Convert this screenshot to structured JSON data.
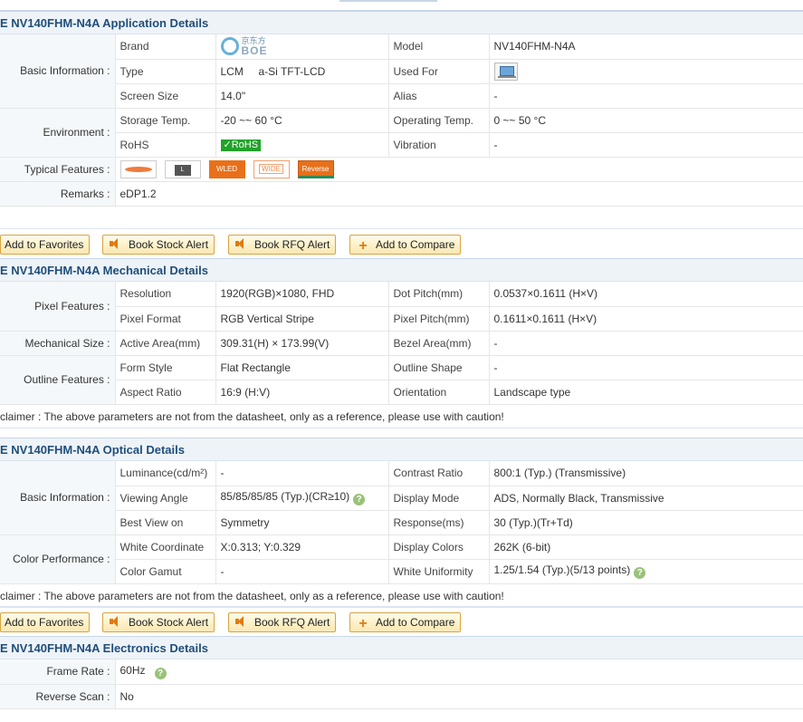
{
  "application": {
    "title": "E NV140FHM-N4A Application Details",
    "groups": {
      "basic": "Basic Information :",
      "environment": "Environment :",
      "features": "Typical Features :",
      "remarks": "Remarks :"
    },
    "rows": {
      "brand_label": "Brand",
      "brand_logo_cn": "京东方",
      "brand_logo_en": "BOE",
      "model_label": "Model",
      "model_value": "NV140FHM-N4A",
      "type_label": "Type",
      "type_value": "LCM     a-Si TFT-LCD",
      "usedfor_label": "Used For",
      "size_label": "Screen Size",
      "size_value": "14.0\"",
      "alias_label": "Alias",
      "alias_value": "-",
      "storage_label": "Storage Temp.",
      "storage_value": "-20 ~~ 60 °C",
      "operating_label": "Operating Temp.",
      "operating_value": "0 ~~ 50 °C",
      "rohs_label": "RoHS",
      "rohs_value": "✓RoHS",
      "vibration_label": "Vibration",
      "vibration_value": "-",
      "remarks_value": "eDP1.2"
    },
    "features": [
      "L",
      "WLED",
      "WIDE",
      "Reverse"
    ]
  },
  "actions": {
    "favorites": "Add to Favorites",
    "stock_alert": "Book Stock Alert",
    "rfq_alert": "Book RFQ Alert",
    "compare": "Add to Compare"
  },
  "mechanical": {
    "title": "E NV140FHM-N4A Mechanical Details",
    "groups": {
      "pixel": "Pixel Features :",
      "size": "Mechanical Size :",
      "outline": "Outline Features :"
    },
    "rows": {
      "resolution_label": "Resolution",
      "resolution_value": "1920(RGB)×1080, FHD",
      "dotpitch_label": "Dot Pitch(mm)",
      "dotpitch_value": "0.0537×0.1611 (H×V)",
      "pixelformat_label": "Pixel Format",
      "pixelformat_value": "RGB Vertical Stripe",
      "pixelpitch_label": "Pixel Pitch(mm)",
      "pixelpitch_value": "0.1611×0.1611 (H×V)",
      "activearea_label": "Active Area(mm)",
      "activearea_value": "309.31(H) × 173.99(V)",
      "bezel_label": "Bezel Area(mm)",
      "bezel_value": "-",
      "formstyle_label": "Form Style",
      "formstyle_value": "Flat Rectangle",
      "outlineshape_label": "Outline Shape",
      "outlineshape_value": "-",
      "aspect_label": "Aspect Ratio",
      "aspect_value": "16:9 (H:V)",
      "orientation_label": "Orientation",
      "orientation_value": "Landscape type"
    },
    "disclaimer": "claimer : The above parameters are not from the datasheet, only as a reference, please use with caution!"
  },
  "optical": {
    "title": "E NV140FHM-N4A Optical Details",
    "groups": {
      "basic": "Basic Information :",
      "color": "Color Performance :"
    },
    "rows": {
      "luminance_label": "Luminance(cd/m²)",
      "luminance_value": "-",
      "contrast_label": "Contrast Ratio",
      "contrast_value": "800:1 (Typ.) (Transmissive)",
      "viewing_label": "Viewing Angle",
      "viewing_value": "85/85/85/85 (Typ.)(CR≥10)",
      "displaymode_label": "Display Mode",
      "displaymode_value": "ADS, Normally Black, Transmissive",
      "bestview_label": "Best View on",
      "bestview_value": "Symmetry",
      "response_label": "Response(ms)",
      "response_value": "30 (Typ.)(Tr+Td)",
      "whitecoord_label": "White Coordinate",
      "whitecoord_value": "X:0.313; Y:0.329",
      "displaycolors_label": "Display Colors",
      "displaycolors_value": "262K (6-bit)",
      "gamut_label": "Color Gamut",
      "gamut_value": "-",
      "uniformity_label": "White Uniformity",
      "uniformity_value": "1.25/1.54 (Typ.)(5/13 points)"
    },
    "disclaimer": "claimer : The above parameters are not from the datasheet, only as a reference, please use with caution!"
  },
  "electronics": {
    "title": "E NV140FHM-N4A Electronics Details",
    "rows": {
      "framerate_label": "Frame Rate :",
      "framerate_value": "60Hz",
      "reversescan_label": "Reverse Scan :",
      "reversescan_value": "No"
    }
  },
  "help_glyph": "?"
}
